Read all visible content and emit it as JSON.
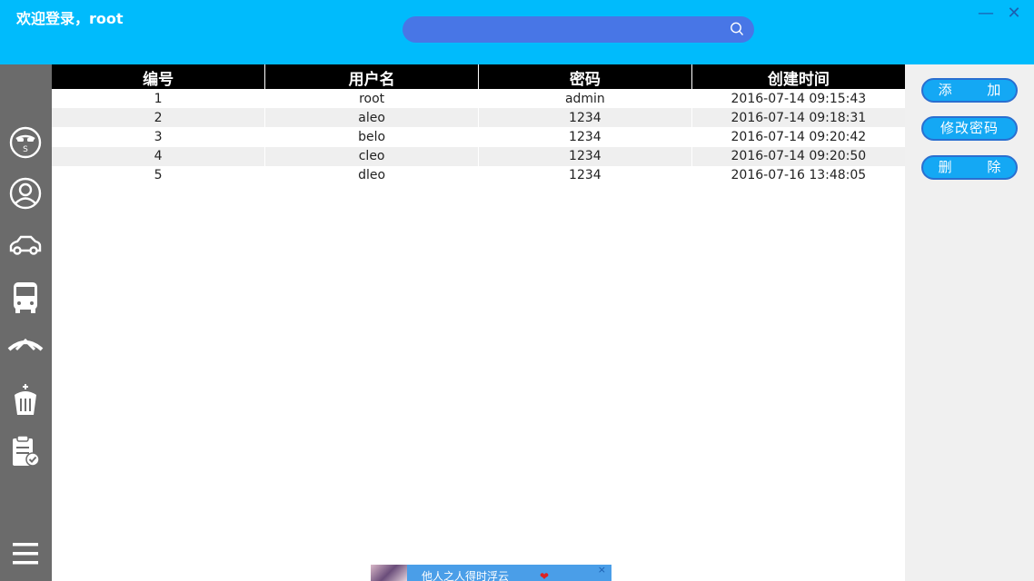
{
  "header": {
    "welcome": "欢迎登录，root",
    "search": {
      "placeholder": ""
    }
  },
  "window": {
    "minimize_glyph": "—",
    "close_glyph": "✕"
  },
  "sidebar": {
    "items": [
      {
        "icon": "money-face-icon"
      },
      {
        "icon": "user-icon"
      },
      {
        "icon": "car-icon"
      },
      {
        "icon": "bus-icon"
      },
      {
        "icon": "infiniti-logo-icon"
      },
      {
        "icon": "crown-icon"
      },
      {
        "icon": "clipboard-check-icon"
      },
      {
        "icon": "menu-icon"
      }
    ]
  },
  "table": {
    "columns": [
      "编号",
      "用户名",
      "密码",
      "创建时间"
    ],
    "rows": [
      [
        "1",
        "root",
        "admin",
        "2016-07-14 09:15:43"
      ],
      [
        "2",
        "aleo",
        "1234",
        "2016-07-14 09:18:31"
      ],
      [
        "3",
        "belo",
        "1234",
        "2016-07-14 09:20:42"
      ],
      [
        "4",
        "cleo",
        "1234",
        "2016-07-14 09:20:50"
      ],
      [
        "5",
        "dleo",
        "1234",
        "2016-07-16 13:48:05"
      ]
    ]
  },
  "actions": {
    "add": "添 加",
    "change_password": "修改密码",
    "delete": "删 除"
  },
  "taskbar_thumb": {
    "text": "他人之人得时浮云",
    "close_glyph": "×",
    "heart_glyph": "❤"
  },
  "colors": {
    "header_bg": "#00bbfc",
    "search_bg": "#4876e6",
    "sidebar_bg": "#6b6b6b",
    "button_bg": "#14a8f4"
  }
}
